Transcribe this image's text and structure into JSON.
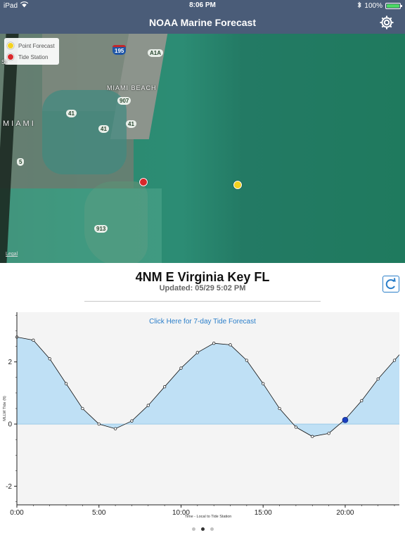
{
  "status": {
    "device": "iPad",
    "time": "8:06 PM",
    "battery": "100%"
  },
  "nav": {
    "title": "NOAA Marine Forecast"
  },
  "map": {
    "legend": {
      "point_forecast": "Point Forecast",
      "tide_station": "Tide Station"
    },
    "labels": {
      "miami_beach": "MIAMI BEACH",
      "miami": "MIAMI",
      "st": "St"
    },
    "shields": {
      "i195": "195",
      "a1a": "A1A",
      "r907": "907",
      "r41a": "41",
      "r41b": "41",
      "r41c": "41",
      "r5": "5",
      "r913": "913"
    },
    "legal": "Legal",
    "colors": {
      "point_forecast": "#f4d21f",
      "tide_station": "#d9282b"
    }
  },
  "station": {
    "title": "4NM E Virginia Key FL",
    "updated": "Updated: 05/29 5:02 PM"
  },
  "chart_data": {
    "type": "area",
    "link_text": "Click Here for 7-day Tide Forecast",
    "xlabel": "Time - Local to Tide Station",
    "ylabel": "MLLW Tide (ft)",
    "x_tick_labels": [
      "0:00",
      "5:00",
      "10:00",
      "15:00",
      "20:00"
    ],
    "x_ticks": [
      0,
      5,
      10,
      15,
      20
    ],
    "y_tick_labels": [
      "-2",
      "0",
      "2"
    ],
    "y_ticks": [
      -2,
      0,
      2
    ],
    "xlim": [
      0,
      23.3
    ],
    "ylim": [
      -2.6,
      3.6
    ],
    "x": [
      0,
      1,
      2,
      3,
      4,
      5,
      6,
      7,
      8,
      9,
      10,
      11,
      12,
      13,
      14,
      15,
      16,
      17,
      18,
      19,
      20,
      21,
      22,
      23
    ],
    "values": [
      2.8,
      2.7,
      2.1,
      1.3,
      0.5,
      0.0,
      -0.15,
      0.1,
      0.6,
      1.2,
      1.8,
      2.3,
      2.6,
      2.55,
      2.05,
      1.3,
      0.5,
      -0.1,
      -0.4,
      -0.3,
      0.15,
      0.75,
      1.45,
      2.05
    ],
    "current": {
      "x": 20,
      "y": 0.13
    },
    "colors": {
      "fill": "#bfe0f5",
      "line": "#111111",
      "current": "#1a3fbf",
      "plot_bg": "#f4f4f4"
    }
  }
}
